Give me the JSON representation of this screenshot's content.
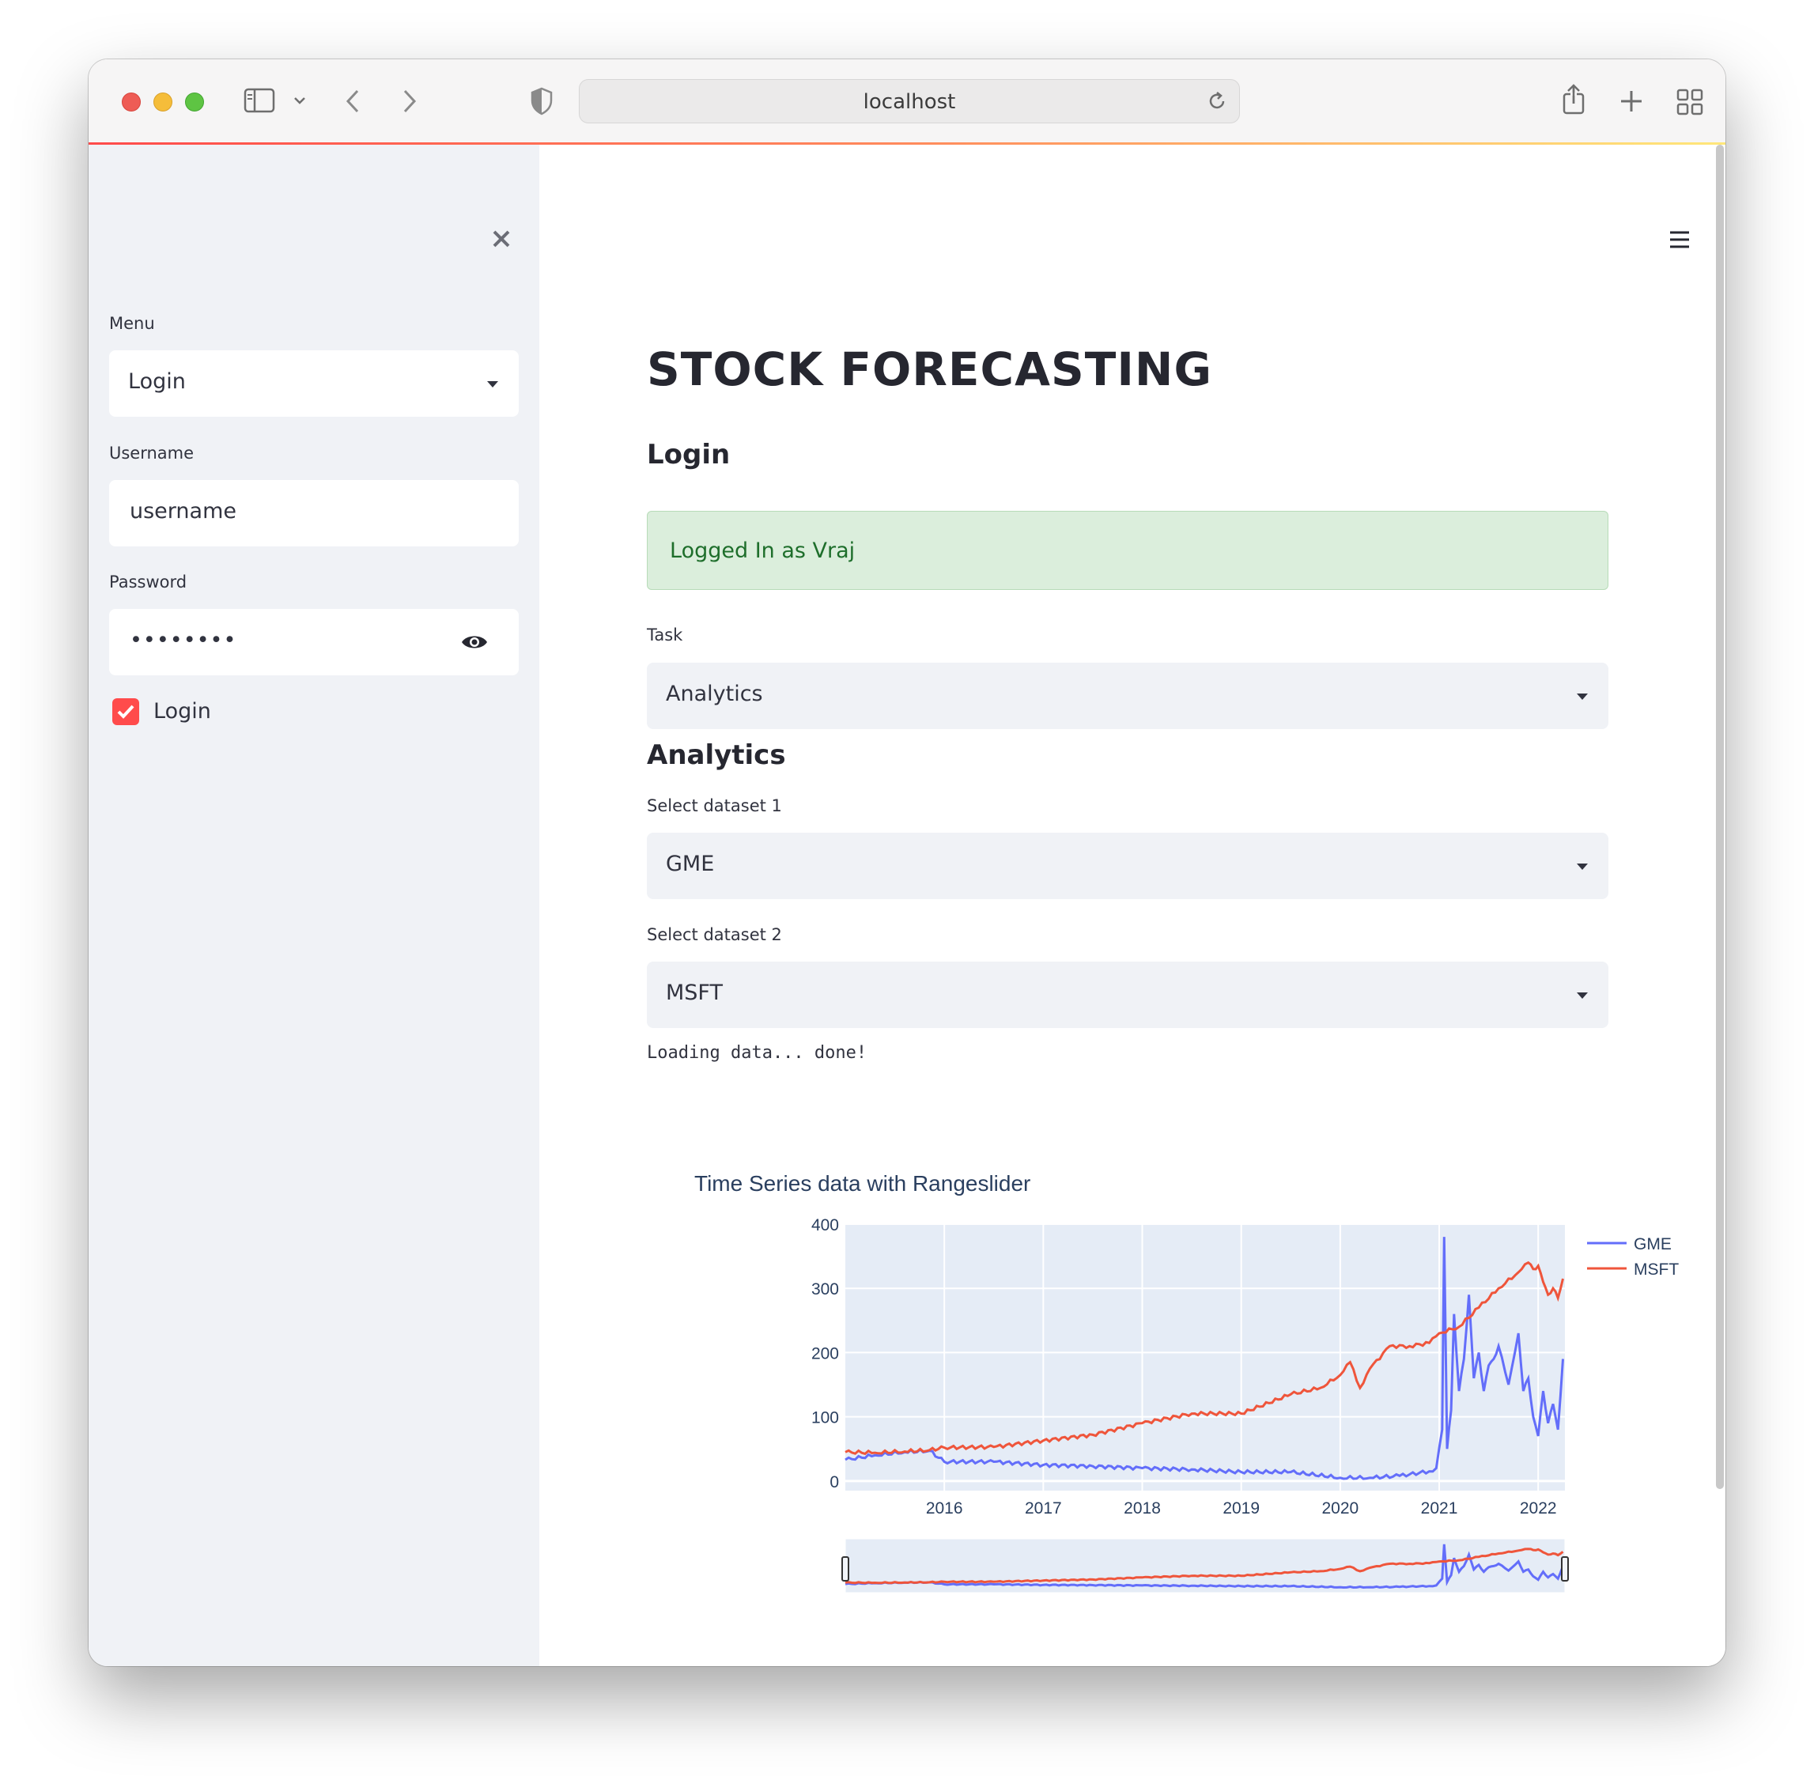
{
  "browser": {
    "address": "localhost"
  },
  "sidebar": {
    "menu_label": "Menu",
    "menu_value": "Login",
    "username_label": "Username",
    "username_value": "username",
    "password_label": "Password",
    "password_value": "••••••••",
    "login_checkbox_label": "Login",
    "login_checked": true
  },
  "main": {
    "title": "STOCK FORECASTING",
    "login_heading": "Login",
    "alert_text": "Logged In as Vraj",
    "task_label": "Task",
    "task_value": "Analytics",
    "analytics_heading": "Analytics",
    "dataset1_label": "Select dataset 1",
    "dataset1_value": "GME",
    "dataset2_label": "Select dataset 2",
    "dataset2_value": "MSFT",
    "status_text": "Loading data... done!"
  },
  "colors": {
    "accent": "#ff4b4b",
    "gme": "#636efa",
    "msft": "#ef553b",
    "success_bg": "#dbeedc",
    "success_text": "#1e6e2b"
  },
  "chart_data": {
    "type": "line",
    "title": "Time Series data with Rangeslider",
    "xlabel": "",
    "ylabel": "",
    "ylim": [
      -15,
      400
    ],
    "xlim": [
      2015.0,
      2022.27
    ],
    "x_ticks": [
      "2016",
      "2017",
      "2018",
      "2019",
      "2020",
      "2021",
      "2022"
    ],
    "y_ticks": [
      "0",
      "100",
      "200",
      "300",
      "400"
    ],
    "legend": "top-right",
    "rangeslider": true,
    "series": [
      {
        "name": "GME",
        "x": [
          2015.0,
          2015.3,
          2015.6,
          2015.85,
          2016.0,
          2016.5,
          2017.0,
          2017.5,
          2018.0,
          2018.5,
          2019.0,
          2019.5,
          2020.0,
          2020.3,
          2020.6,
          2020.9,
          2020.97,
          2021.03,
          2021.05,
          2021.08,
          2021.12,
          2021.15,
          2021.2,
          2021.25,
          2021.3,
          2021.35,
          2021.4,
          2021.45,
          2021.5,
          2021.55,
          2021.6,
          2021.7,
          2021.8,
          2021.85,
          2021.9,
          2021.95,
          2022.0,
          2022.05,
          2022.1,
          2022.15,
          2022.2,
          2022.25
        ],
        "values": [
          33,
          40,
          45,
          47,
          30,
          30,
          25,
          23,
          20,
          18,
          14,
          14,
          5,
          5,
          8,
          15,
          20,
          80,
          380,
          50,
          110,
          260,
          140,
          190,
          290,
          160,
          200,
          140,
          180,
          190,
          210,
          150,
          230,
          140,
          160,
          100,
          70,
          140,
          90,
          120,
          80,
          190
        ]
      },
      {
        "name": "MSFT",
        "x": [
          2015.0,
          2015.3,
          2015.6,
          2015.85,
          2016.0,
          2016.5,
          2017.0,
          2017.5,
          2018.0,
          2018.5,
          2019.0,
          2019.5,
          2019.8,
          2020.0,
          2020.1,
          2020.2,
          2020.3,
          2020.5,
          2020.7,
          2020.9,
          2021.0,
          2021.2,
          2021.4,
          2021.6,
          2021.8,
          2021.9,
          2021.95,
          2022.0,
          2022.05,
          2022.1,
          2022.15,
          2022.2,
          2022.25
        ],
        "values": [
          45,
          44,
          46,
          48,
          52,
          53,
          63,
          72,
          90,
          105,
          105,
          135,
          145,
          165,
          185,
          145,
          175,
          210,
          210,
          215,
          230,
          240,
          270,
          300,
          325,
          340,
          330,
          335,
          310,
          290,
          300,
          285,
          315
        ]
      }
    ]
  }
}
